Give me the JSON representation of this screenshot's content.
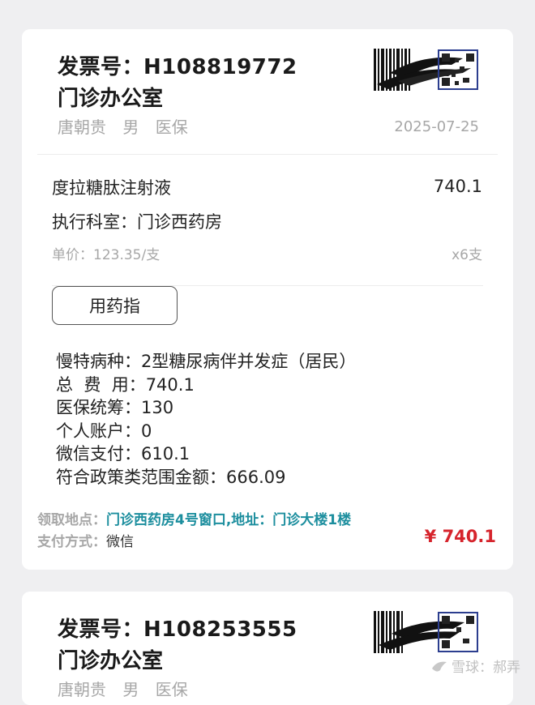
{
  "invoices": [
    {
      "invoice_label": "发票号：H108819772",
      "department": "门诊办公室",
      "patient_line": "唐朝贵 男 医保",
      "date": "2025-07-25",
      "drug_name": "度拉糖肽注射液",
      "drug_total": "740.1",
      "exec_dept": "执行科室：门诊西药房",
      "unit_price": "单价：123.35/支",
      "quantity": "x6支",
      "guide_button": "用药指",
      "details": [
        "慢特病种：2型糖尿病伴并发症（居民）",
        "总  费  用：740.1",
        "医保统筹：130",
        "个人账户：0",
        "微信支付：610.1",
        "符合政策类范围金额：666.09"
      ],
      "pickup_label": "领取地点：",
      "pickup_value": "门诊西药房4号窗口,地址：门诊大楼1楼",
      "pay_label": "支付方式：",
      "pay_value": "微信",
      "amount": "¥ 740.1"
    },
    {
      "invoice_label": "发票号：H108253555",
      "department": "门诊办公室",
      "patient_line": "唐朝贵 男 医保"
    }
  ],
  "watermark": "雪球：郝弄",
  "colors": {
    "accent_teal": "#1c8e9e",
    "amount_red": "#d6242c",
    "muted_gray": "#a7a7a7"
  },
  "icons": [
    "qr-code-icon",
    "barcode-icon",
    "snowball-logo-icon"
  ]
}
